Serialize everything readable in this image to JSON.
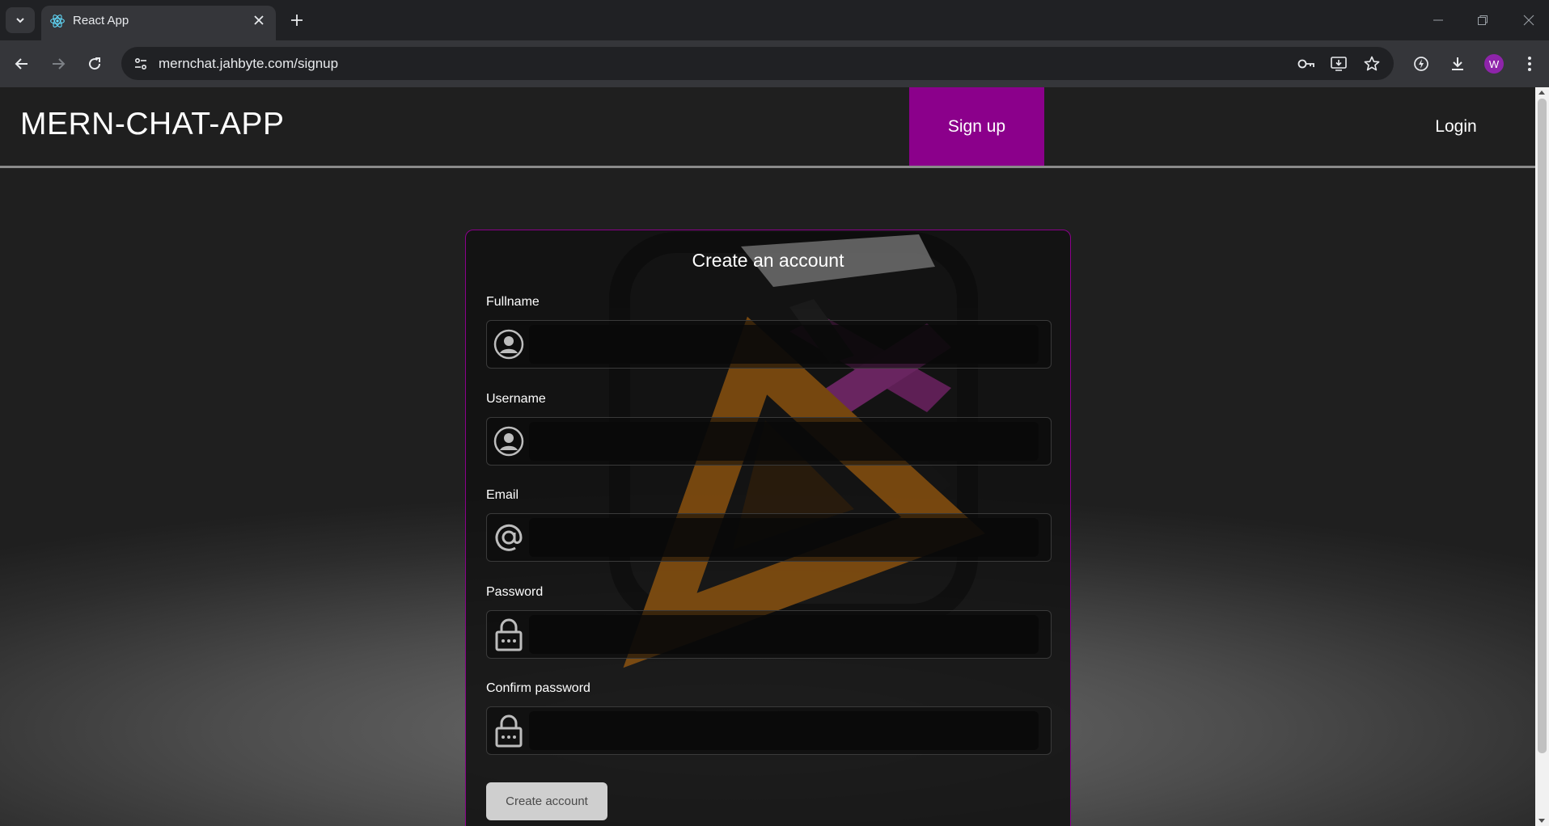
{
  "browser": {
    "tab": {
      "title": "React App"
    },
    "address_bar": {
      "url": "mernchat.jahbyte.com/signup"
    },
    "profile_initial": "W",
    "icons": [
      "tab-search-icon",
      "react-favicon-icon",
      "close-tab-icon",
      "new-tab-icon",
      "minimize-icon",
      "restore-icon",
      "close-window-icon",
      "back-icon",
      "forward-icon",
      "reload-icon",
      "site-info-icon",
      "password-key-icon",
      "install-app-icon",
      "bookmark-star-icon",
      "performance-icon",
      "downloads-icon",
      "menu-icon"
    ]
  },
  "app": {
    "brand": "MERN-CHAT-APP",
    "nav": {
      "signup": "Sign up",
      "login": "Login"
    },
    "accent_color": "#8b008b"
  },
  "signup_form": {
    "title": "Create an account",
    "fields": [
      {
        "label": "Fullname",
        "icon": "user-circle-icon",
        "value": ""
      },
      {
        "label": "Username",
        "icon": "user-circle-icon",
        "value": ""
      },
      {
        "label": "Email",
        "icon": "at-sign-icon",
        "value": ""
      },
      {
        "label": "Password",
        "icon": "lock-icon",
        "value": ""
      },
      {
        "label": "Confirm password",
        "icon": "lock-icon",
        "value": ""
      }
    ],
    "submit_label": "Create account"
  }
}
